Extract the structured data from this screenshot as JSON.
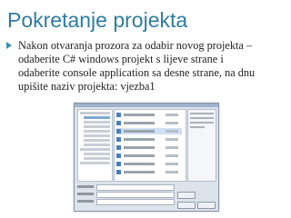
{
  "slide": {
    "title": "Pokretanje projekta",
    "bullet_lines": [
      "Nakon otvaranja prozora za odabir novog projekta –",
      "odaberite C# windows projekt s lijeve strane i",
      "odaberite console application sa desne strane, na dnu",
      "upišite naziv projekta: vjezba1"
    ]
  },
  "colors": {
    "title": "#2f7ca2",
    "bullet": "#3e8fb0",
    "text": "#222222"
  },
  "screenshot": {
    "description_icon": "new-project-dialog-thumbnail"
  }
}
